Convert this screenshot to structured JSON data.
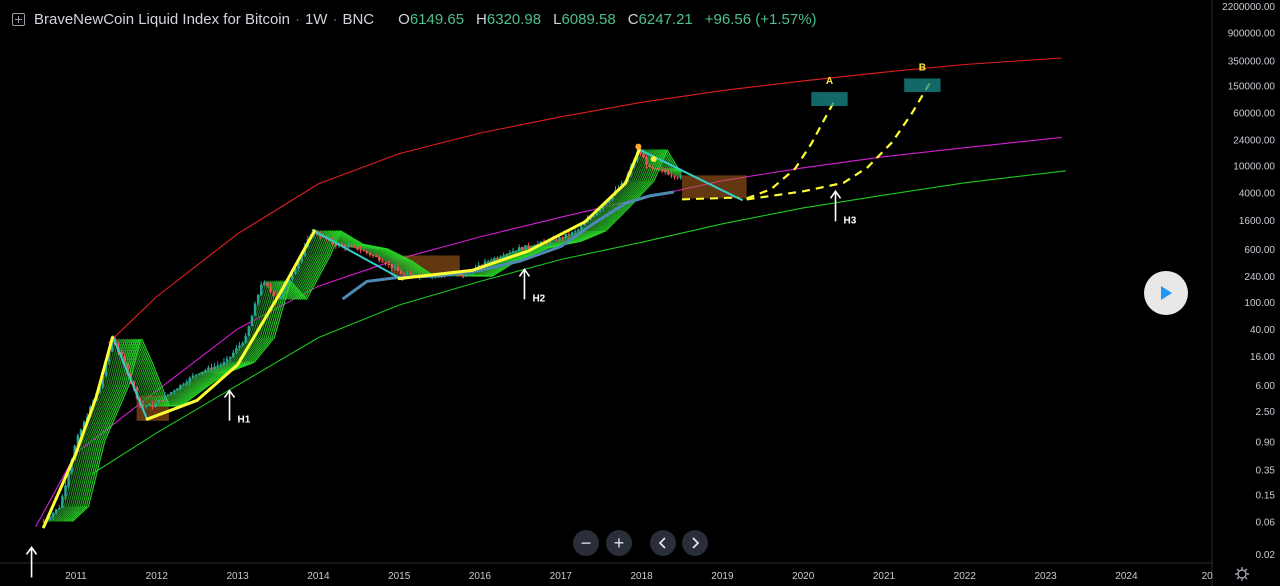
{
  "header": {
    "title": "BraveNewCoin Liquid Index for Bitcoin",
    "interval": "1W",
    "exchange": "BNC",
    "open_label": "O",
    "open": "6149.65",
    "high_label": "H",
    "high": "6320.98",
    "low_label": "L",
    "low": "6089.58",
    "close_label": "C",
    "close": "6247.21",
    "change": "+96.56 (+1.57%)"
  },
  "colors": {
    "background": "#000000",
    "up_candle": "#26a69a",
    "down_candle": "#ef5350",
    "red_band": "#e01e1e",
    "magenta_band": "#d21ed2",
    "green_band": "#1ec81e",
    "yellow_curve": "#ffff33",
    "cyan_line": "#33cccc",
    "moving_average": "#4d8ab3",
    "annotation": "#ffffff"
  },
  "chart_data": {
    "type": "line",
    "title": "BraveNewCoin Liquid Index for Bitcoin",
    "y_scale": "log",
    "x_ticks": [
      "2011",
      "2012",
      "2013",
      "2014",
      "2015",
      "2016",
      "2017",
      "2018",
      "2019",
      "2020",
      "2021",
      "2022",
      "2023",
      "2024",
      "20"
    ],
    "y_ticks": [
      "2200000.00",
      "900000.00",
      "350000.00",
      "150000.00",
      "60000.00",
      "24000.00",
      "10000.00",
      "4000.00",
      "1600.00",
      "600.00",
      "240.00",
      "100.00",
      "40.00",
      "16.00",
      "6.00",
      "2.50",
      "0.90",
      "0.35",
      "0.15",
      "0.06",
      "0.02"
    ],
    "series": [
      {
        "name": "",
        "role": "price",
        "x": [
          2010.6,
          2010.8,
          2011.0,
          2011.3,
          2011.45,
          2011.6,
          2011.8,
          2011.95,
          2012.2,
          2012.5,
          2012.85,
          2013.1,
          2013.3,
          2013.5,
          2013.8,
          2013.92,
          2014.2,
          2014.5,
          2014.8,
          2015.05,
          2015.4,
          2015.8,
          2016.1,
          2016.5,
          2016.9,
          2017.2,
          2017.5,
          2017.8,
          2017.96,
          2018.1,
          2018.3,
          2018.5
        ],
        "y": [
          0.06,
          0.1,
          0.9,
          6,
          30,
          12,
          3,
          3,
          5,
          9,
          13,
          30,
          200,
          110,
          500,
          1100,
          700,
          600,
          400,
          250,
          250,
          240,
          400,
          620,
          780,
          1100,
          2500,
          6000,
          17000,
          9000,
          8000,
          6500
        ]
      },
      {
        "name": "",
        "role": "upper-band",
        "x": [
          2011.4,
          2012,
          2013,
          2014,
          2015,
          2016,
          2017,
          2018,
          2019,
          2020,
          2021,
          2022,
          2023.2
        ],
        "y": [
          25,
          120,
          1000,
          5400,
          15000,
          30000,
          52000,
          85000,
          126000,
          175000,
          235000,
          305000,
          380000
        ]
      },
      {
        "name": "",
        "role": "middle-band",
        "x": [
          2010.5,
          2011,
          2012,
          2013,
          2014,
          2015,
          2016,
          2017,
          2018,
          2019,
          2020,
          2021,
          2022,
          2023.2
        ],
        "y": [
          0.05,
          0.6,
          5,
          40,
          170,
          430,
          900,
          1750,
          3300,
          6000,
          9300,
          13500,
          18300,
          26000
        ]
      },
      {
        "name": "",
        "role": "lower-band",
        "x": [
          2011.2,
          2012,
          2013,
          2014,
          2015,
          2016,
          2017,
          2018,
          2019,
          2020,
          2021,
          2022,
          2023.25
        ],
        "y": [
          0.3,
          1.2,
          6,
          30,
          90,
          200,
          420,
          750,
          1400,
          2400,
          3700,
          5600,
          8400
        ]
      },
      {
        "name": "",
        "role": "moving-average",
        "x": [
          2014.3,
          2014.6,
          2015,
          2015.5,
          2016,
          2016.5,
          2017,
          2017.4,
          2017.8,
          2018.1,
          2018.4
        ],
        "y": [
          110,
          200,
          230,
          240,
          290,
          400,
          650,
          1400,
          2800,
          3600,
          4100
        ]
      },
      {
        "name": "",
        "role": "projection-A",
        "x": [
          2019.3,
          2019.6,
          2019.9,
          2020.1,
          2020.25,
          2020.4
        ],
        "y": [
          3300,
          4500,
          9000,
          21000,
          45000,
          95000
        ]
      },
      {
        "name": "",
        "role": "projection-B",
        "x": [
          2019.3,
          2020,
          2020.5,
          2020.8,
          2021.1,
          2021.35,
          2021.6
        ],
        "y": [
          3200,
          4200,
          5600,
          9500,
          22000,
          60000,
          190000
        ]
      }
    ],
    "cycles": [
      {
        "peak": [
          2011.45,
          32
        ],
        "bottom": [
          2011.88,
          1.9
        ],
        "next": [
          2012.85,
          4.5
        ]
      },
      {
        "peak": [
          2013.92,
          1150
        ],
        "bottom": [
          2015.05,
          210
        ],
        "next": [
          2016.55,
          620
        ]
      },
      {
        "peak": [
          2017.96,
          17500
        ],
        "bottom": [
          2019.25,
          3100
        ],
        "next": null
      }
    ],
    "annotations": [
      {
        "label": "",
        "x": 2010.45,
        "y": 0.025
      },
      {
        "label": "H1",
        "x": 2012.9,
        "y": 5
      },
      {
        "label": "H2",
        "x": 2016.55,
        "y": 300
      },
      {
        "label": "H3",
        "x": 2020.4,
        "y": 4200
      }
    ],
    "targets": [
      {
        "label": "A",
        "x": [
          2020.1,
          2020.55
        ],
        "y": [
          75000,
          120000
        ]
      },
      {
        "label": "B",
        "x": [
          2021.25,
          2021.7
        ],
        "y": [
          120000,
          190000
        ]
      }
    ],
    "xlabel": "",
    "ylabel": "",
    "grid": false
  },
  "controls": {
    "zoom_out": "−",
    "zoom_in": "+"
  }
}
